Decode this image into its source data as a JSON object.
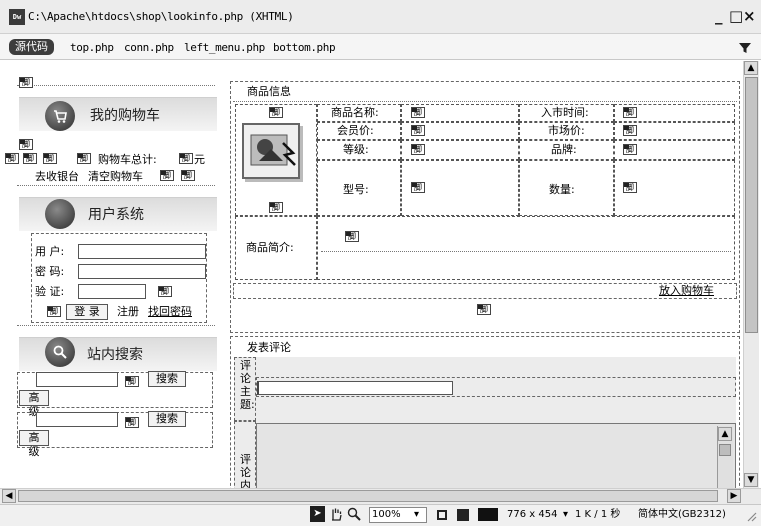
{
  "window": {
    "app_icon": "Dw",
    "title": "C:\\Apache\\htdocs\\shop\\lookinfo.php (XHTML)",
    "minimize": "_",
    "maximize": "□",
    "close": "×"
  },
  "docbar": {
    "source_label": "源代码",
    "files": [
      "top.php",
      "conn.php",
      "left_menu.php",
      "bottom.php"
    ]
  },
  "placeholder_glyph": "脚",
  "cart": {
    "title": "我的购物车",
    "total_label": "购物车总计:",
    "unit": "元",
    "checkout": "去收银台",
    "clear": "清空购物车"
  },
  "user": {
    "title": "用户系统",
    "username_label": "用 户:",
    "password_label": "密 码:",
    "verify_label": "验 证:",
    "login": "登 录",
    "register": "注册",
    "recover": "找回密码"
  },
  "search": {
    "title": "站内搜索",
    "button": "搜索",
    "advanced": "高级"
  },
  "product": {
    "section_title": "商品信息",
    "name_label": "商品名称:",
    "date_label": "入市时间:",
    "member_price_label": "会员价:",
    "market_price_label": "市场价:",
    "grade_label": "等级:",
    "brand_label": "品牌:",
    "model_label": "型号:",
    "qty_label": "数量:",
    "intro_label": "商品简介:",
    "add_to_cart": "放入购物车"
  },
  "comment": {
    "section_title": "发表评论",
    "subject_label": "评论主题:",
    "content_label": "评论内"
  },
  "status": {
    "zoom": "100%",
    "dimensions": "776 x 454",
    "file_info": "1 K / 1 秒",
    "encoding": "简体中文(GB2312)"
  }
}
